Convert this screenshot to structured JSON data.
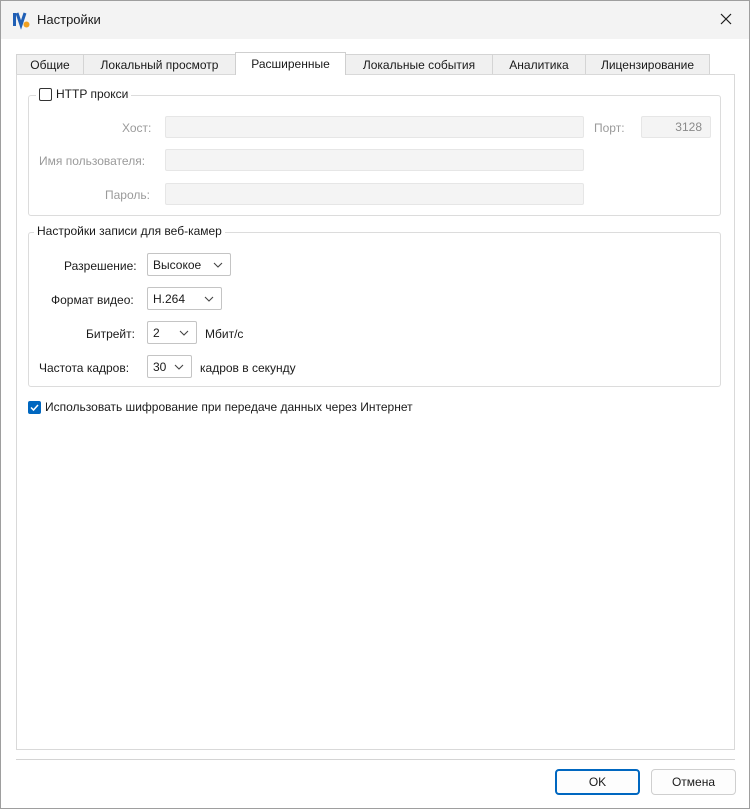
{
  "window": {
    "title": "Настройки",
    "app_icon": "iv-logo-icon",
    "close_icon": "close-icon"
  },
  "tabs": [
    {
      "label": "Общие",
      "active": false
    },
    {
      "label": "Локальный просмотр",
      "active": false
    },
    {
      "label": "Расширенные",
      "active": true
    },
    {
      "label": "Локальные события",
      "active": false
    },
    {
      "label": "Аналитика",
      "active": false
    },
    {
      "label": "Лицензирование",
      "active": false
    }
  ],
  "http_proxy": {
    "checkbox_label": "HTTP прокси",
    "checked": false,
    "host_label": "Хост:",
    "host_value": "",
    "port_label": "Порт:",
    "port_value": "3128",
    "username_label": "Имя пользователя:",
    "username_value": "",
    "password_label": "Пароль:",
    "password_value": ""
  },
  "webcam": {
    "group_title": "Настройки записи для веб-камер",
    "resolution_label": "Разрешение:",
    "resolution_value": "Высокое",
    "format_label": "Формат видео:",
    "format_value": "H.264",
    "bitrate_label": "Битрейт:",
    "bitrate_value": "2",
    "bitrate_unit": "Мбит/с",
    "fps_label": "Частота кадров:",
    "fps_value": "30",
    "fps_unit": "кадров в секунду"
  },
  "encryption": {
    "label": "Использовать шифрование при передаче данных через Интернет",
    "checked": true
  },
  "buttons": {
    "ok": "OK",
    "cancel": "Отмена"
  },
  "colors": {
    "accent": "#0067c0",
    "disabled_text": "#9a9a9a"
  }
}
